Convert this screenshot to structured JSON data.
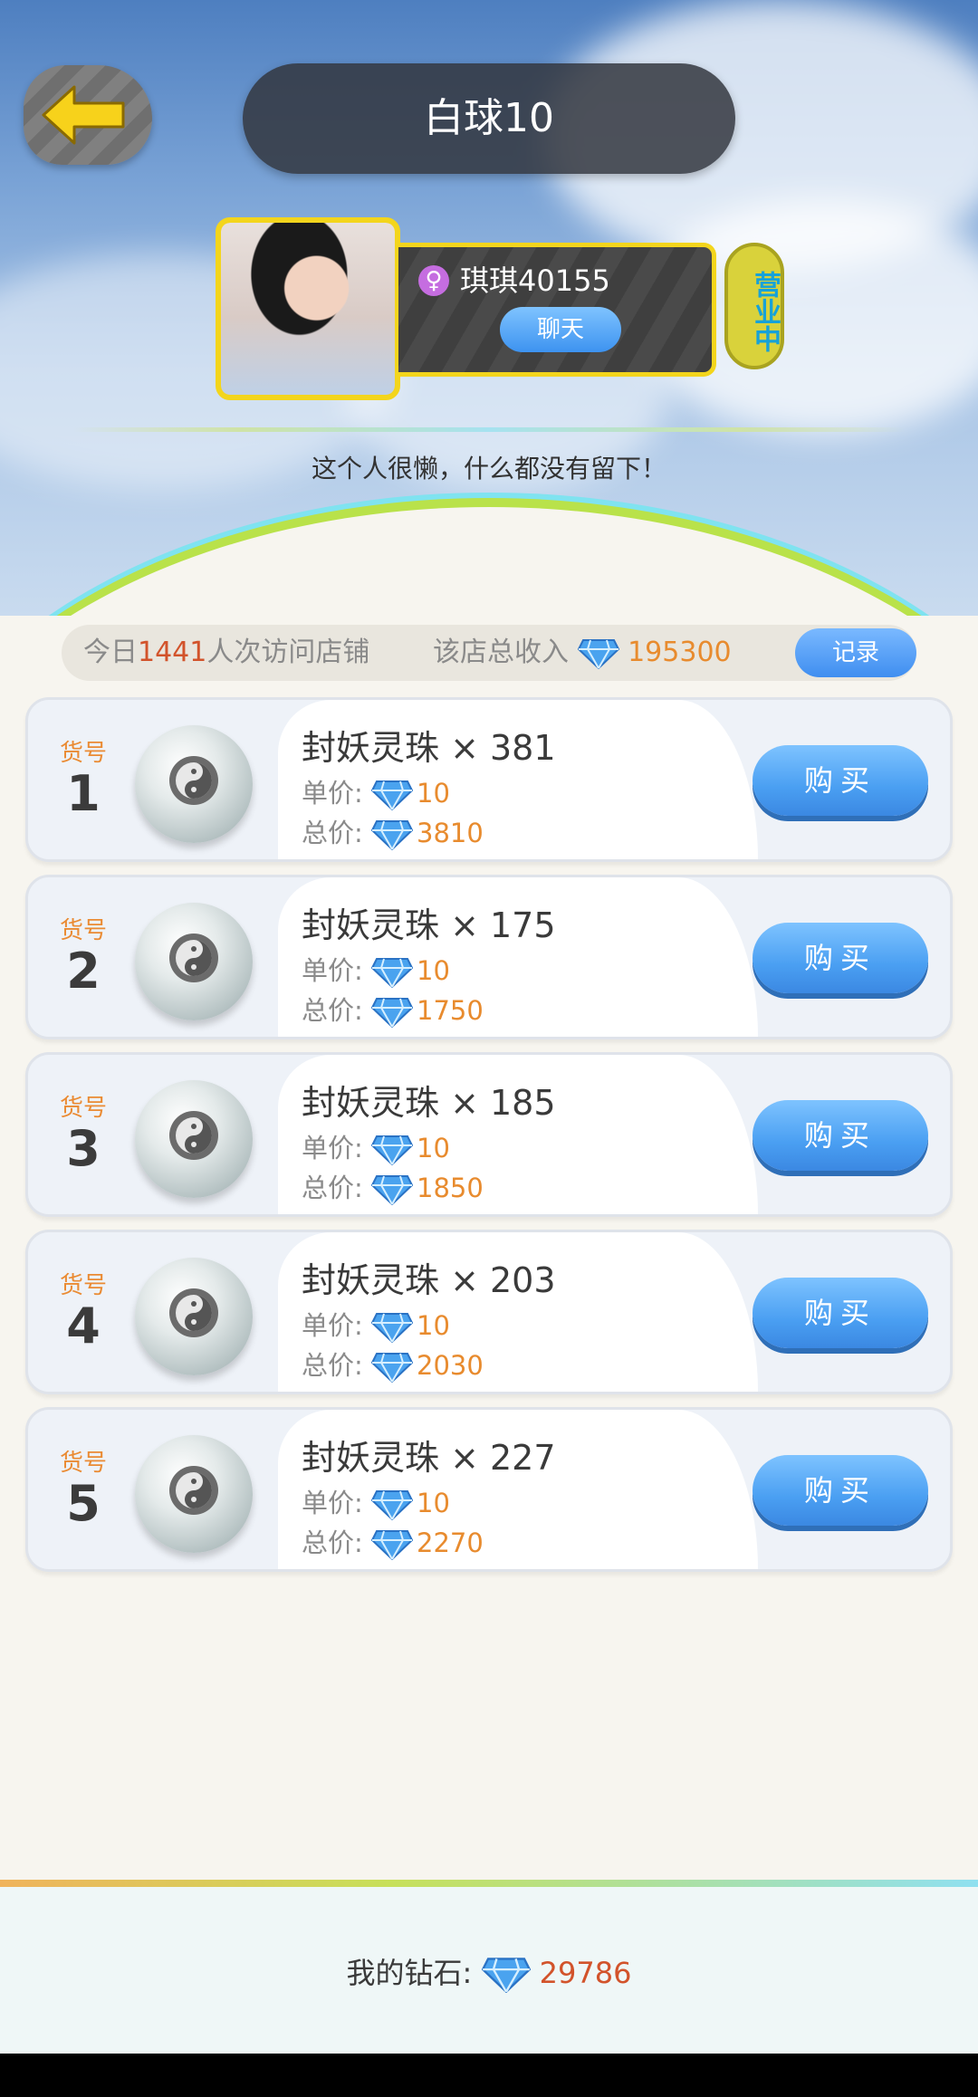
{
  "header": {
    "title": "白球10",
    "back_icon": "back-arrow-icon"
  },
  "profile": {
    "gender_symbol": "♀",
    "username": "琪琪40155",
    "chat_label": "聊天",
    "status": "营业中",
    "bio": "这个人很懒，什么都没有留下！"
  },
  "stats": {
    "visits_prefix": "今日",
    "visits_count": "1441",
    "visits_suffix": "人次访问店铺",
    "income_label": "该店总收入",
    "income_value": "195300",
    "record_label": "记录"
  },
  "items": [
    {
      "no_label": "货号",
      "no": "1",
      "name": "封妖灵珠 × 381",
      "unit_label": "单价:",
      "unit_price": "10",
      "total_label": "总价:",
      "total_price": "3810",
      "buy_label": "购买"
    },
    {
      "no_label": "货号",
      "no": "2",
      "name": "封妖灵珠 × 175",
      "unit_label": "单价:",
      "unit_price": "10",
      "total_label": "总价:",
      "total_price": "1750",
      "buy_label": "购买"
    },
    {
      "no_label": "货号",
      "no": "3",
      "name": "封妖灵珠 × 185",
      "unit_label": "单价:",
      "unit_price": "10",
      "total_label": "总价:",
      "total_price": "1850",
      "buy_label": "购买"
    },
    {
      "no_label": "货号",
      "no": "4",
      "name": "封妖灵珠 × 203",
      "unit_label": "单价:",
      "unit_price": "10",
      "total_label": "总价:",
      "total_price": "2030",
      "buy_label": "购买"
    },
    {
      "no_label": "货号",
      "no": "5",
      "name": "封妖灵珠 × 227",
      "unit_label": "单价:",
      "unit_price": "10",
      "total_label": "总价:",
      "total_price": "2270",
      "buy_label": "购买"
    }
  ],
  "footer": {
    "wallet_label": "我的钻石:",
    "wallet_value": "29786"
  },
  "colors": {
    "accent_yellow": "#f3d51c",
    "button_blue": "#4a9ff2",
    "price_orange": "#e88b2e",
    "visits_red": "#d2532b"
  }
}
